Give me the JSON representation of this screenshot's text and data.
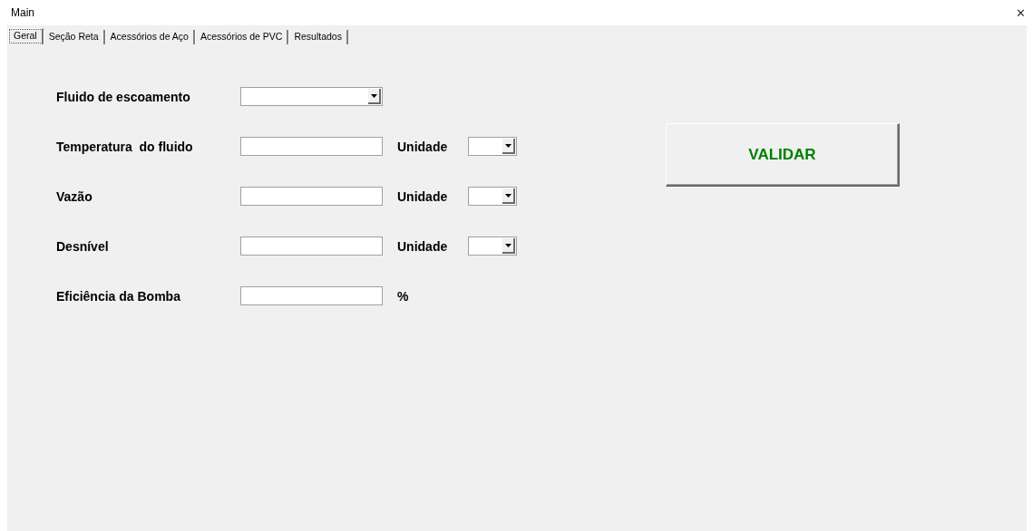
{
  "window": {
    "title": "Main",
    "close": "✕"
  },
  "tabs": [
    {
      "label": "Geral",
      "selected": true
    },
    {
      "label": "Seção Reta",
      "selected": false
    },
    {
      "label": "Acessórios de Aço",
      "selected": false
    },
    {
      "label": "Acessórios de PVC",
      "selected": false
    },
    {
      "label": "Resultados",
      "selected": false
    }
  ],
  "form": [
    {
      "label": "Fluido de escoamento",
      "kind": "combo"
    },
    {
      "label": "Temperatura  do fluido",
      "kind": "text",
      "unit": {
        "label": "Unidade",
        "kind": "combo"
      }
    },
    {
      "label": "Vazão",
      "kind": "text",
      "unit": {
        "label": "Unidade",
        "kind": "combo"
      }
    },
    {
      "label": "Desnível",
      "kind": "text",
      "unit": {
        "label": "Unidade",
        "kind": "combo"
      }
    },
    {
      "label": "Eficiência da Bomba",
      "kind": "text",
      "unit": {
        "label": "%",
        "kind": "suffix"
      }
    }
  ],
  "validate_button": "VALIDAR"
}
